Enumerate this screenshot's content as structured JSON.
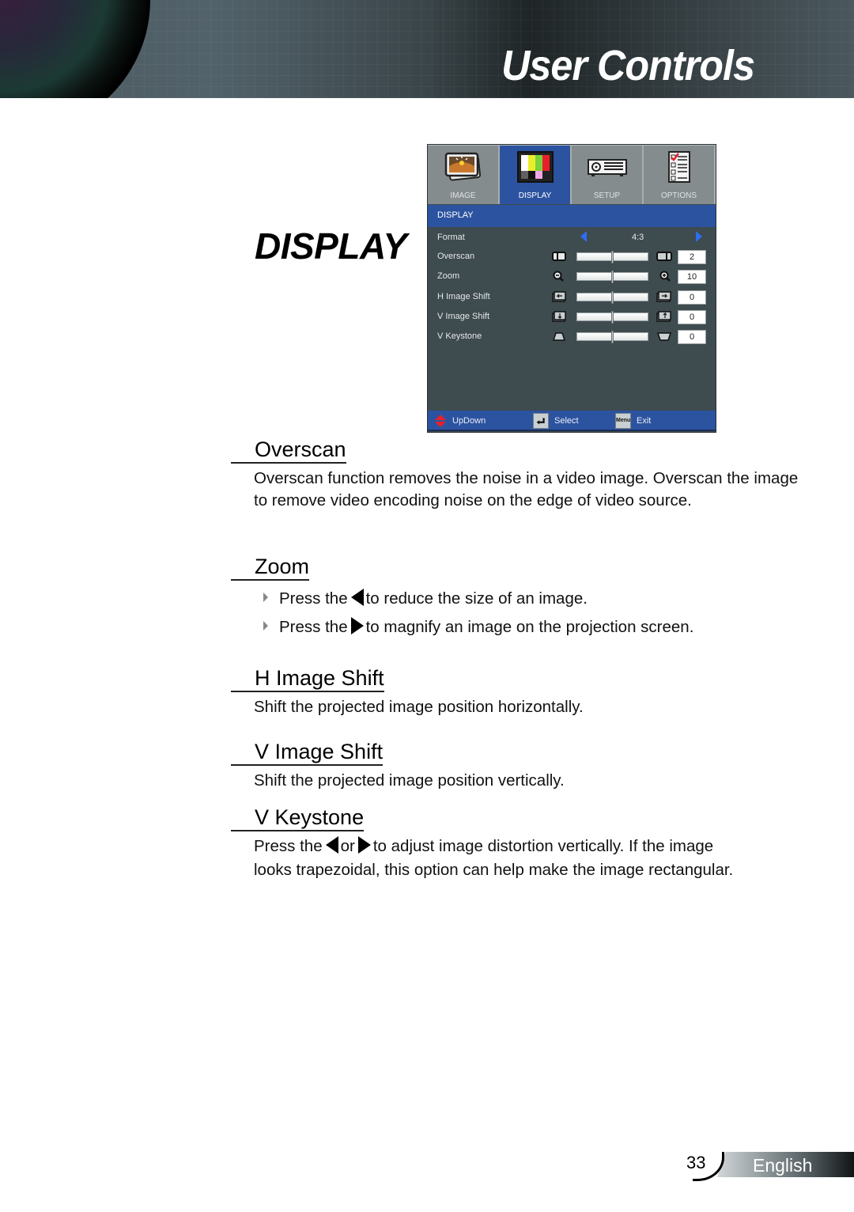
{
  "header": {
    "title": "User Controls"
  },
  "page_title": "DISPLAY",
  "osd": {
    "tabs": [
      {
        "label": "IMAGE",
        "icon": "image-icon",
        "active": false
      },
      {
        "label": "DISPLAY",
        "icon": "display-test-pattern-icon",
        "active": true
      },
      {
        "label": "SETUP",
        "icon": "projector-icon",
        "active": false
      },
      {
        "label": "OPTIONS",
        "icon": "checklist-icon",
        "active": false
      }
    ],
    "subheader": "DISPLAY",
    "format": {
      "label": "Format",
      "value": "4:3"
    },
    "rows": [
      {
        "label": "Overscan",
        "value": "2",
        "level": 0.5,
        "icon_left": "overscan-decrease-icon",
        "icon_right": "overscan-increase-icon"
      },
      {
        "label": "Zoom",
        "value": "10",
        "level": 0.5,
        "icon_left": "zoom-out-icon",
        "icon_right": "zoom-in-icon"
      },
      {
        "label": "H Image Shift",
        "value": "0",
        "level": 0.5,
        "icon_left": "shift-left-icon",
        "icon_right": "shift-right-icon"
      },
      {
        "label": "V Image Shift",
        "value": "0",
        "level": 0.5,
        "icon_left": "shift-down-icon",
        "icon_right": "shift-up-icon"
      },
      {
        "label": "V Keystone",
        "value": "0",
        "level": 0.5,
        "icon_left": "keystone-narrow-top-icon",
        "icon_right": "keystone-narrow-bottom-icon"
      }
    ],
    "footer": {
      "updown": "UpDown",
      "select": "Select",
      "menu_key": "Menu",
      "exit": "Exit"
    },
    "colors": {
      "accent": "#2c53a0",
      "panel": "#3e4b4f",
      "arrow": "#2f6cf0"
    }
  },
  "sections": {
    "overscan": {
      "title": "Overscan",
      "body": "Overscan function removes the noise in a video image. Overscan the image to remove video encoding noise on the edge of video source."
    },
    "zoom": {
      "title": "Zoom",
      "bullets": [
        {
          "pre": "Press the",
          "post": "to reduce the size of an image.",
          "arrow": "left"
        },
        {
          "pre": "Press the",
          "post": "to magnify an image on the projection screen.",
          "arrow": "right"
        }
      ]
    },
    "h_image_shift": {
      "title": "H Image Shift",
      "body": "Shift the projected image position horizontally."
    },
    "v_image_shift": {
      "title": "V Image Shift",
      "body": "Shift the projected image position vertically."
    },
    "v_keystone": {
      "title": "V Keystone",
      "pre": "Press the",
      "mid": "or",
      "post": "to adjust image distortion vertically. If the image",
      "line2": "looks trapezoidal, this option can help make the image rectangular."
    }
  },
  "footer": {
    "page_number": "33",
    "language": "English"
  }
}
